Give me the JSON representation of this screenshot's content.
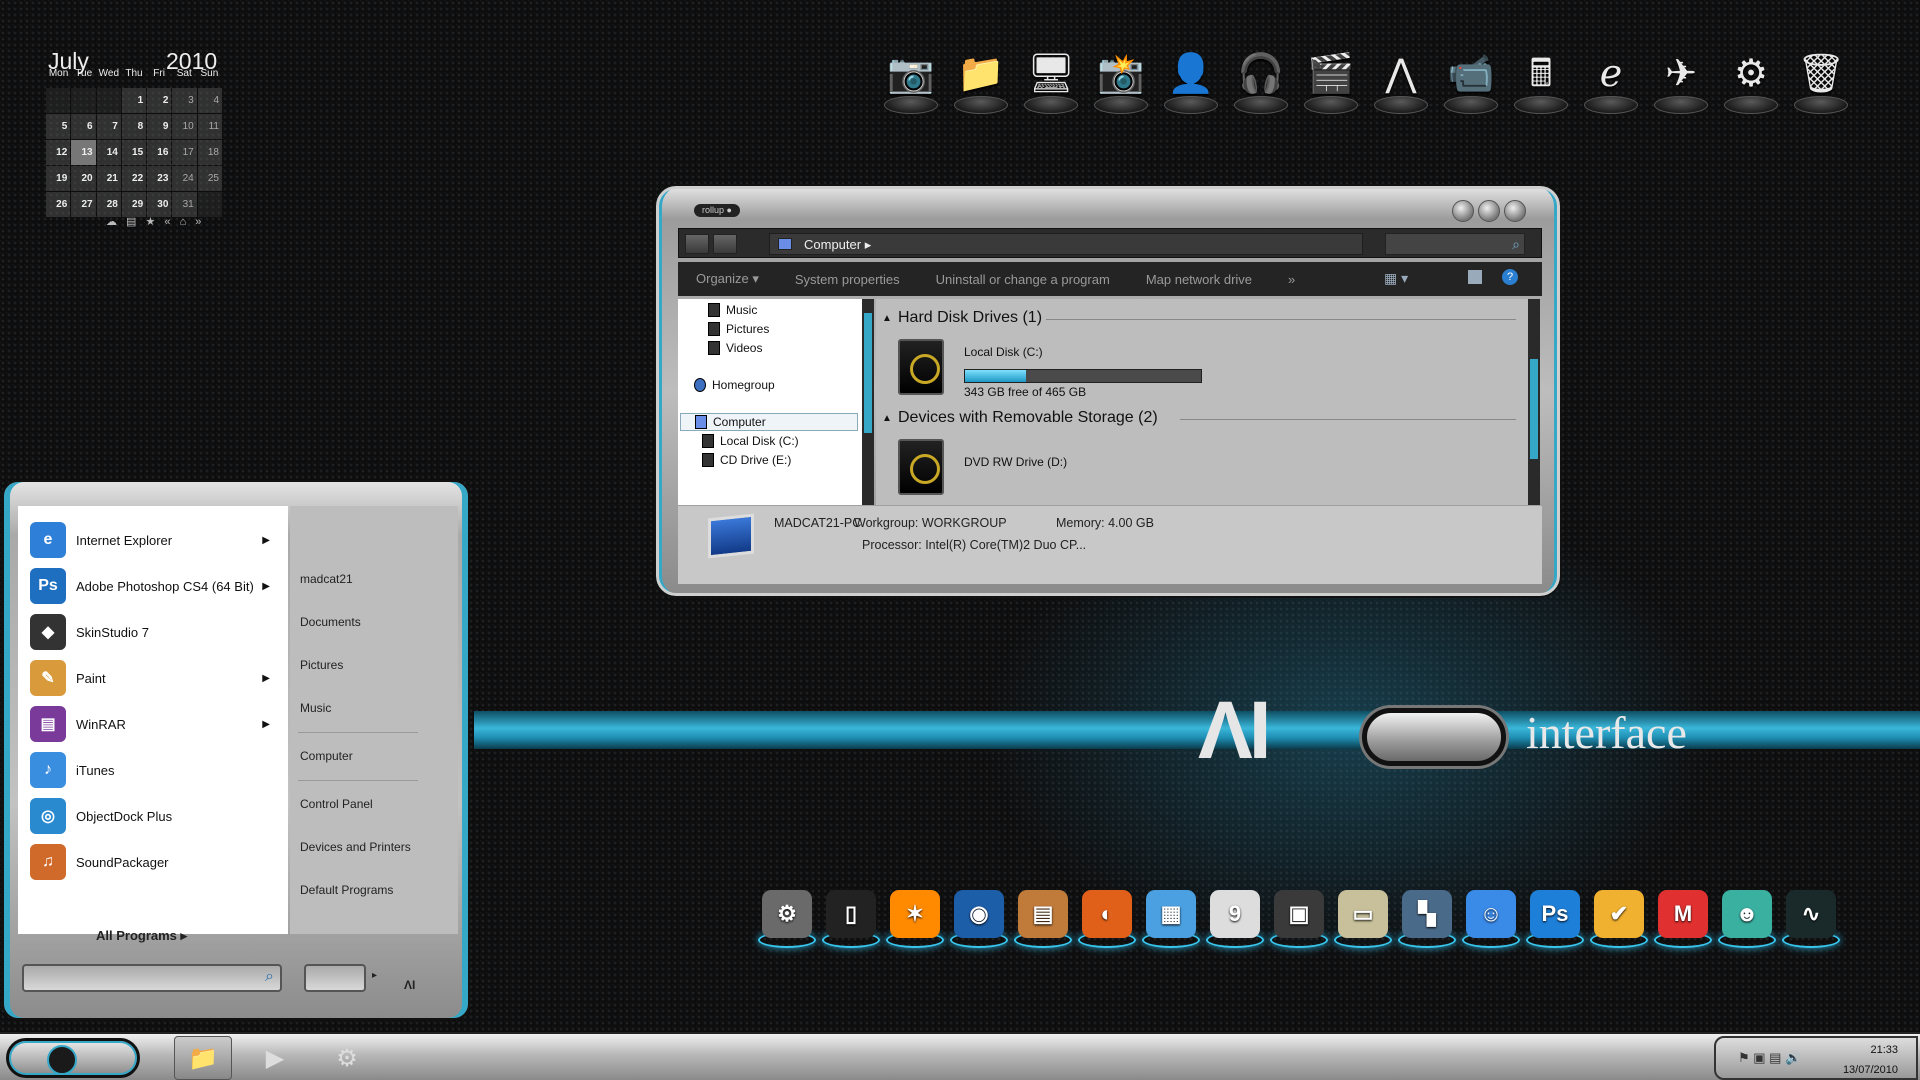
{
  "calendar": {
    "month": "July",
    "year": "2010",
    "weekdays": [
      "Mon",
      "Tue",
      "Wed",
      "Thu",
      "Fri",
      "Sat",
      "Sun"
    ],
    "weeks": [
      [
        "",
        "",
        "",
        "1",
        "2",
        "3",
        "4"
      ],
      [
        "5",
        "6",
        "7",
        "8",
        "9",
        "10",
        "11"
      ],
      [
        "12",
        "13",
        "14",
        "15",
        "16",
        "17",
        "18"
      ],
      [
        "19",
        "20",
        "21",
        "22",
        "23",
        "24",
        "25"
      ],
      [
        "26",
        "27",
        "28",
        "29",
        "30",
        "31",
        ""
      ]
    ],
    "today": "13",
    "controls": "☁ ▤ ★ « ⌂ »"
  },
  "top_dock": [
    {
      "icon": "camera-icon",
      "glyph": "📷"
    },
    {
      "icon": "folder-icon",
      "glyph": "📁"
    },
    {
      "icon": "computer-icon",
      "glyph": "🖥"
    },
    {
      "icon": "photo-camera-icon",
      "glyph": "📸"
    },
    {
      "icon": "user-folder-icon",
      "glyph": "👤"
    },
    {
      "icon": "headphones-icon",
      "glyph": "🎧"
    },
    {
      "icon": "clapperboard-icon",
      "glyph": "🎬"
    },
    {
      "icon": "bird-icon",
      "glyph": "⋀"
    },
    {
      "icon": "video-camera-icon",
      "glyph": "📹"
    },
    {
      "icon": "calculator-icon",
      "glyph": "🖩"
    },
    {
      "icon": "internet-explorer-icon",
      "glyph": "ℯ"
    },
    {
      "icon": "swallow-icon",
      "glyph": "✈"
    },
    {
      "icon": "gear-icon",
      "glyph": "⚙"
    },
    {
      "icon": "trash-icon",
      "glyph": "🗑"
    }
  ],
  "explorer": {
    "rollup_label": "rollup ●",
    "address": "Computer",
    "commands": [
      "Organize ▾",
      "System properties",
      "Uninstall or change a program",
      "Map network drive",
      "»"
    ],
    "nav_items": [
      {
        "label": "Music",
        "type": "lib"
      },
      {
        "label": "Pictures",
        "type": "lib"
      },
      {
        "label": "Videos",
        "type": "lib"
      },
      {
        "label": "Homegroup",
        "type": "hg"
      },
      {
        "label": "Computer",
        "type": "sel"
      },
      {
        "label": "Local Disk (C:)",
        "type": "lib"
      },
      {
        "label": "CD Drive (E:)",
        "type": "lib"
      }
    ],
    "group1": "Hard Disk Drives (1)",
    "drive_c_name": "Local Disk (C:)",
    "drive_c_free": "343 GB free of 465 GB",
    "drive_c_used_fraction": 0.26,
    "group2": "Devices with Removable Storage (2)",
    "drive_d_name": "DVD RW Drive (D:)",
    "details": {
      "pc_name": "MADCAT21-PC",
      "workgroup": "Workgroup: WORKGROUP",
      "memory": "Memory: 4.00 GB",
      "processor": "Processor: Intel(R) Core(TM)2 Duo CP..."
    }
  },
  "logo": {
    "ai": "ΛI",
    "word": "interface"
  },
  "bottom_dock": [
    {
      "icon": "system-preferences-icon",
      "glyph": "⚙",
      "color": "#6a6a6a"
    },
    {
      "icon": "iphone-icon",
      "glyph": "▯",
      "color": "#222222"
    },
    {
      "icon": "avast-icon",
      "glyph": "✶",
      "color": "#ff8a00"
    },
    {
      "icon": "angry-bird-icon",
      "glyph": "◉",
      "color": "#1d5ea8"
    },
    {
      "icon": "archive-icon",
      "glyph": "▤",
      "color": "#c07a3a"
    },
    {
      "icon": "firefox-icon",
      "glyph": "◐",
      "color": "#e0601a"
    },
    {
      "icon": "clapper-icon",
      "glyph": "▦",
      "color": "#4aa0e0"
    },
    {
      "icon": "ical-icon",
      "glyph": "9",
      "color": "#dddddd"
    },
    {
      "icon": "cinema-icon",
      "glyph": "▣",
      "color": "#3a3a3a"
    },
    {
      "icon": "tv-icon",
      "glyph": "▭",
      "color": "#c7c09a"
    },
    {
      "icon": "dashboard-icon",
      "glyph": "▚",
      "color": "#4a6a8a"
    },
    {
      "icon": "finder-icon",
      "glyph": "☺",
      "color": "#3a8ae8"
    },
    {
      "icon": "photoshop-icon",
      "glyph": "Ps",
      "color": "#1e7fd8"
    },
    {
      "icon": "tasks-icon",
      "glyph": "✔",
      "color": "#f0b030"
    },
    {
      "icon": "gmail-icon",
      "glyph": "M",
      "color": "#e03030"
    },
    {
      "icon": "messenger-icon",
      "glyph": "☻",
      "color": "#3ab0a0"
    },
    {
      "icon": "activity-monitor-icon",
      "glyph": "∿",
      "color": "#1a2a2a"
    }
  ],
  "start_menu": {
    "apps": [
      {
        "label": "Internet Explorer",
        "arrow": true,
        "glyph": "e",
        "color": "#2d7fd8",
        "icon": "internet-explorer-icon"
      },
      {
        "label": "Adobe Photoshop CS4 (64 Bit)",
        "arrow": true,
        "glyph": "Ps",
        "color": "#1e6fc0",
        "icon": "photoshop-icon"
      },
      {
        "label": "SkinStudio 7",
        "arrow": false,
        "glyph": "◆",
        "color": "#333333",
        "icon": "skinstudio-icon"
      },
      {
        "label": "Paint",
        "arrow": true,
        "glyph": "✎",
        "color": "#d89a3a",
        "icon": "paint-icon"
      },
      {
        "label": "WinRAR",
        "arrow": true,
        "glyph": "▤",
        "color": "#7a3a9a",
        "icon": "winrar-icon"
      },
      {
        "label": "iTunes",
        "arrow": false,
        "glyph": "♪",
        "color": "#3a8ee0",
        "icon": "itunes-icon"
      },
      {
        "label": "ObjectDock Plus",
        "arrow": false,
        "glyph": "◎",
        "color": "#2a8ad0",
        "icon": "objectdock-icon"
      },
      {
        "label": "SoundPackager",
        "arrow": false,
        "glyph": "♫",
        "color": "#d06a2a",
        "icon": "soundpackager-icon"
      }
    ],
    "all_programs": "All Programs",
    "places": [
      "madcat21",
      "Documents",
      "Pictures",
      "Music",
      "Computer",
      "Control Panel",
      "Devices and Printers",
      "Default Programs"
    ]
  },
  "taskbar": {
    "items": [
      {
        "icon": "explorer-folder-icon",
        "glyph": "📁",
        "active": true
      },
      {
        "icon": "media-player-icon",
        "glyph": "▶",
        "active": false
      },
      {
        "icon": "media-center-icon",
        "glyph": "⚙",
        "active": false
      }
    ],
    "tray_icons": "⚑ ▣ ▤ 🔊",
    "time": "21:33",
    "date": "13/07/2010"
  }
}
